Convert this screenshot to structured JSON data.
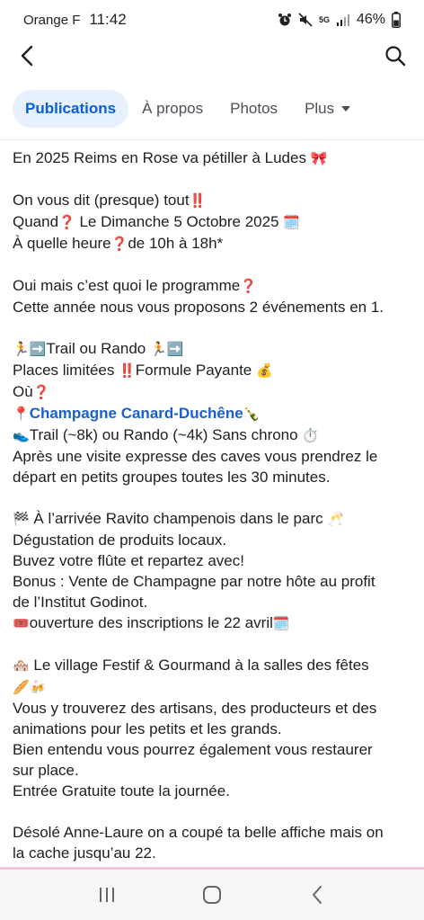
{
  "status_bar": {
    "carrier": "Orange F",
    "time": "11:42",
    "network": "5G",
    "battery": "46%",
    "icons": [
      "alarm-icon",
      "mute-icon",
      "network-icon",
      "signal-icon",
      "battery-icon"
    ]
  },
  "top_nav": {
    "back_icon": "chevron-left-icon",
    "search_icon": "search-icon"
  },
  "tabs": [
    {
      "label": "Publications",
      "active": true
    },
    {
      "label": "À propos",
      "active": false
    },
    {
      "label": "Photos",
      "active": false
    },
    {
      "label": "Plus",
      "active": false,
      "icon": "caret-down-icon"
    }
  ],
  "colors": {
    "accent": "#0a5fd6",
    "tab_active_bg": "#e7f0fd",
    "link": "#1a5fd0",
    "alert_red": "#e02020"
  },
  "post": {
    "line_01": "En 2025 Reims en Rose va pétiller à Ludes",
    "line_01_emoji": "🎀",
    "line_02": "On vous dit (presque) tout",
    "line_02_emoji": "‼️",
    "line_03_a": "Quand",
    "line_03_q": "❓",
    "line_03_b": " Le Dimanche 5 Octobre 2025 ",
    "line_03_cal": "🗓️",
    "line_04_a": "À quelle heure",
    "line_04_q": "❓",
    "line_04_b": "de 10h à 18h*",
    "line_05_a": "Oui mais c’est quoi le programme",
    "line_05_q": "❓",
    "line_06": "Cette année nous vous proposons 2 événements en 1.",
    "line_07_pre": "🏃➡️",
    "line_07": "Trail ou Rando ",
    "line_07_post": "🏃➡️",
    "line_08_a": "Places limitées ",
    "line_08_bang": "‼️",
    "line_08_b": "Formule Payante ",
    "line_08_bag": "💰",
    "line_09": "Où",
    "line_09_q": "❓",
    "line_10_pin": "📍",
    "line_10_link": "Champagne Canard-Duchêne",
    "line_10_bottle": "🍾",
    "line_11_shoe": "👟",
    "line_11": "Trail (~8k) ou Rando (~4k) Sans chrono ",
    "line_11_timer": "⏱️",
    "line_12": "Après une visite expresse des caves vous prendrez le",
    "line_13": "départ en petits groupes toutes les 30 minutes.",
    "line_14_flag": "🏁",
    "line_14": " À l’arrivée Ravito champenois dans le parc ",
    "line_14_glasses": "🥂",
    "line_15": "Dégustation de produits locaux.",
    "line_16": "Buvez votre flûte et repartez avec!",
    "line_17": "Bonus : Vente de Champagne par notre hôte au profit",
    "line_18": "de l’Institut Godinot.",
    "line_19_ticket": "🎟️",
    "line_19": "ouverture des inscriptions le 22 avril",
    "line_19_cal": "🗓️",
    "line_20_house": "🏘️",
    "line_20": " Le village Festif & Gourmand à la salles des fêtes",
    "line_21_emoji": "🥖🍻",
    "line_22": "Vous y trouverez des artisans, des producteurs et des",
    "line_23": "animations pour les petits et les grands.",
    "line_24": "Bien entendu vous pourrez également vous restaurer",
    "line_25": "sur place.",
    "line_26": "Entrée Gratuite toute la journée.",
    "line_27": "Désolé Anne-Laure on a coupé ta belle affiche mais on",
    "line_28": "la cache jusqu’au 22."
  },
  "system_nav": {
    "recents_icon": "recent-apps-icon",
    "home_icon": "home-icon",
    "back_icon": "back-icon"
  }
}
